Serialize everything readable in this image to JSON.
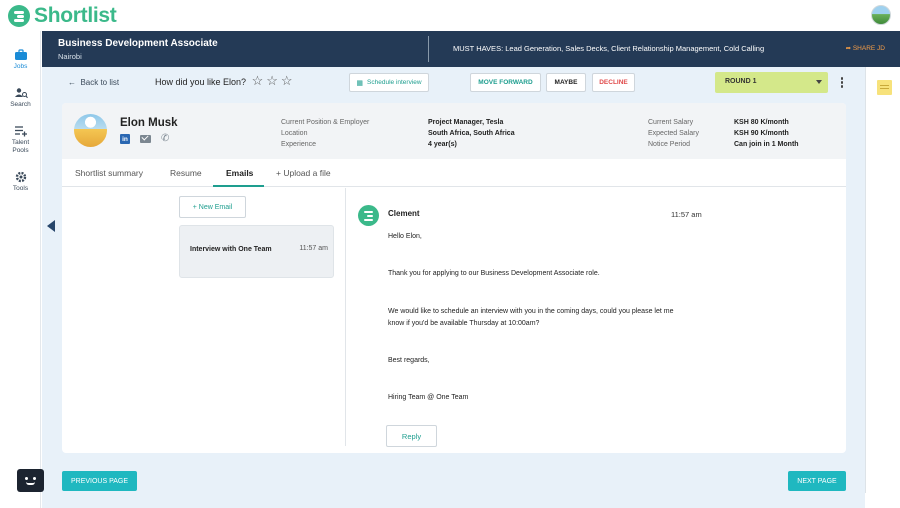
{
  "app": {
    "name": "Shortlist"
  },
  "sidebar": {
    "items": [
      {
        "label": "Jobs",
        "icon": "briefcase-icon",
        "active": true
      },
      {
        "label": "Search",
        "icon": "search-people-icon"
      },
      {
        "label": "Talent Pools",
        "icon": "list-add-icon"
      },
      {
        "label": "Tools",
        "icon": "gear-icon"
      }
    ]
  },
  "job": {
    "title": "Business Development Associate",
    "location": "Nairobi",
    "must_haves": "MUST HAVES: Lead Generation, Sales Decks, Client Relationship Management, Cold Calling",
    "share_label": "SHARE JD"
  },
  "actions": {
    "back_label": "Back to list",
    "rating_question": "How did you like Elon?",
    "stars": [
      "☆",
      "☆",
      "☆"
    ],
    "schedule_label": "Schedule interview",
    "move_forward_label": "MOVE FORWARD",
    "maybe_label": "MAYBE",
    "decline_label": "DECLINE",
    "round_selected": "ROUND 1"
  },
  "candidate": {
    "name": "Elon Musk",
    "labels_left": [
      "Current Position & Employer",
      "Location",
      "Experience"
    ],
    "values_left": [
      "Project Manager, Tesla",
      "South Africa, South Africa",
      "4 year(s)"
    ],
    "labels_right": [
      "Current Salary",
      "Expected Salary",
      "Notice Period"
    ],
    "values_right": [
      "KSH 80 K/month",
      "KSH 90 K/month",
      "Can join in 1 Month"
    ]
  },
  "tabs": [
    "Shortlist summary",
    "Resume",
    "Emails",
    "+ Upload a file"
  ],
  "emails": {
    "new_email_label": "+ New Email",
    "threads": [
      {
        "subject": "Interview with One Team",
        "time": "11:57 am"
      }
    ],
    "message": {
      "sender": "Clement",
      "time": "11:57 am",
      "greeting": "Hello Elon,",
      "para1": "Thank you for applying to our Business Development Associate role.",
      "para2a": "We would like to schedule an interview with you in the coming days, could you please let me",
      "para2b": "know if you'd be available Thursday at 10:00am?",
      "closing": "Best regards,",
      "signature": "Hiring Team @ One Team"
    },
    "reply_label": "Reply"
  },
  "pagination": {
    "prev_label": "PREVIOUS PAGE",
    "next_label": "NEXT PAGE"
  },
  "colors": {
    "brand": "#3bb98a",
    "header": "#243a56",
    "accent": "#1e9e8f",
    "round": "#d4e88a",
    "decline": "#e04b4b",
    "page_button": "#1fb8c0"
  }
}
